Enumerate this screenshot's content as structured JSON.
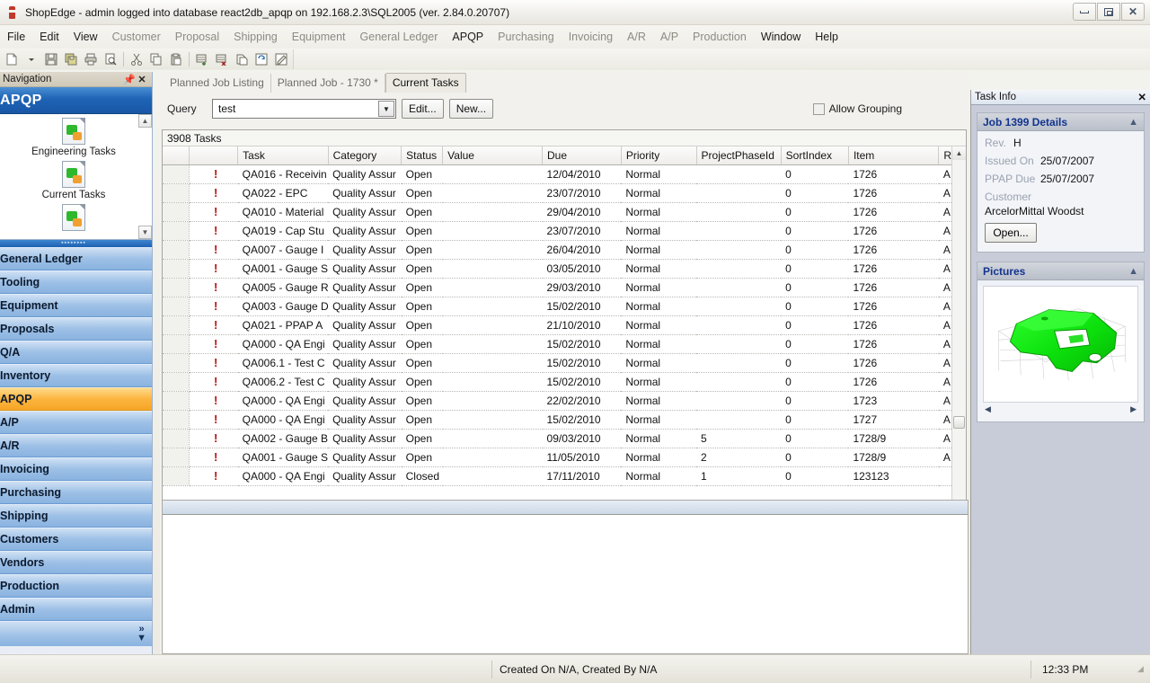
{
  "window": {
    "title": "ShopEdge - admin logged into database react2db_apqp on 192.168.2.3\\SQL2005 (ver. 2.84.0.20707)",
    "app_icon": "shopedge-icon",
    "minimize": "minimize-icon",
    "maximize": "maximize-icon",
    "close": "close-icon"
  },
  "menubar": {
    "items": [
      {
        "label": "File",
        "active": true
      },
      {
        "label": "Edit",
        "active": true
      },
      {
        "label": "View",
        "active": true
      },
      {
        "label": "Customer",
        "active": false
      },
      {
        "label": "Proposal",
        "active": false
      },
      {
        "label": "Shipping",
        "active": false
      },
      {
        "label": "Equipment",
        "active": false
      },
      {
        "label": "General Ledger",
        "active": false
      },
      {
        "label": "APQP",
        "active": true
      },
      {
        "label": "Purchasing",
        "active": false
      },
      {
        "label": "Invoicing",
        "active": false
      },
      {
        "label": "A/R",
        "active": false
      },
      {
        "label": "A/P",
        "active": false
      },
      {
        "label": "Production",
        "active": false
      },
      {
        "label": "Window",
        "active": true
      },
      {
        "label": "Help",
        "active": true
      }
    ]
  },
  "toolbar": {
    "buttons": [
      "new-document-icon",
      "new-dropdown-icon",
      "save-icon",
      "save-all-icon",
      "print-icon",
      "print-preview-icon",
      "cut-icon",
      "copy-icon",
      "paste-icon",
      "add-record-icon",
      "delete-record-icon",
      "copy-record-icon",
      "refresh-icon",
      "edit-note-icon"
    ]
  },
  "navigation": {
    "header_title": "Navigation",
    "pin_icon": "pin-icon",
    "close_icon": "close-icon",
    "section_title": "APQP",
    "shortcuts": [
      {
        "label": "Engineering Tasks",
        "icon": "puzzle-document-icon"
      },
      {
        "label": "Current Tasks",
        "icon": "puzzle-document-icon"
      },
      {
        "label": "",
        "icon": "puzzle-document-icon"
      }
    ],
    "scroll_up_icon": "chevron-up-icon",
    "scroll_down_icon": "chevron-down-icon",
    "groups": [
      {
        "label": "General Ledger",
        "selected": false
      },
      {
        "label": "Tooling",
        "selected": false
      },
      {
        "label": "Equipment",
        "selected": false
      },
      {
        "label": "Proposals",
        "selected": false
      },
      {
        "label": "Q/A",
        "selected": false
      },
      {
        "label": "Inventory",
        "selected": false
      },
      {
        "label": "APQP",
        "selected": true
      },
      {
        "label": "A/P",
        "selected": false
      },
      {
        "label": "A/R",
        "selected": false
      },
      {
        "label": "Invoicing",
        "selected": false
      },
      {
        "label": "Purchasing",
        "selected": false
      },
      {
        "label": "Shipping",
        "selected": false
      },
      {
        "label": "Customers",
        "selected": false
      },
      {
        "label": "Vendors",
        "selected": false
      },
      {
        "label": "Production",
        "selected": false
      },
      {
        "label": "Admin",
        "selected": false
      }
    ],
    "overflow_icon": "chevrons-right-icon"
  },
  "tabs": [
    {
      "label": "Planned Job Listing",
      "active": false
    },
    {
      "label": "Planned Job - 1730 *",
      "active": false
    },
    {
      "label": "Current Tasks",
      "active": true
    }
  ],
  "query": {
    "label": "Query",
    "value": "test",
    "placeholder": "",
    "dropdown_icon": "chevron-down-icon",
    "edit_label": "Edit...",
    "new_label": "New...",
    "allow_grouping_label": "Allow Grouping",
    "allow_grouping_checked": false
  },
  "grid": {
    "status_text": "3908 Tasks",
    "columns": [
      "",
      "",
      "Task",
      "Category",
      "Status",
      "Value",
      "Due",
      "Priority",
      "ProjectPhaseId",
      "SortIndex",
      "Item",
      "Rev"
    ],
    "flag_icon": "alert-exclamation-icon",
    "rows": [
      {
        "flag": "!",
        "task": "QA016 - Receivin",
        "category": "Quality Assur",
        "status": "Open",
        "value": "",
        "due": "12/04/2010",
        "priority": "Normal",
        "phase": "",
        "sortindex": "0",
        "item": "1726",
        "rev": "A"
      },
      {
        "flag": "!",
        "task": "QA022 - EPC",
        "category": "Quality Assur",
        "status": "Open",
        "value": "",
        "due": "23/07/2010",
        "priority": "Normal",
        "phase": "",
        "sortindex": "0",
        "item": "1726",
        "rev": "A"
      },
      {
        "flag": "!",
        "task": "QA010 - Material",
        "category": "Quality Assur",
        "status": "Open",
        "value": "",
        "due": "29/04/2010",
        "priority": "Normal",
        "phase": "",
        "sortindex": "0",
        "item": "1726",
        "rev": "A"
      },
      {
        "flag": "!",
        "task": "QA019 - Cap Stu",
        "category": "Quality Assur",
        "status": "Open",
        "value": "",
        "due": "23/07/2010",
        "priority": "Normal",
        "phase": "",
        "sortindex": "0",
        "item": "1726",
        "rev": "A"
      },
      {
        "flag": "!",
        "task": "QA007 - Gauge I",
        "category": "Quality Assur",
        "status": "Open",
        "value": "",
        "due": "26/04/2010",
        "priority": "Normal",
        "phase": "",
        "sortindex": "0",
        "item": "1726",
        "rev": "A"
      },
      {
        "flag": "!",
        "task": "QA001 - Gauge S",
        "category": "Quality Assur",
        "status": "Open",
        "value": "",
        "due": "03/05/2010",
        "priority": "Normal",
        "phase": "",
        "sortindex": "0",
        "item": "1726",
        "rev": "A"
      },
      {
        "flag": "!",
        "task": "QA005 - Gauge R",
        "category": "Quality Assur",
        "status": "Open",
        "value": "",
        "due": "29/03/2010",
        "priority": "Normal",
        "phase": "",
        "sortindex": "0",
        "item": "1726",
        "rev": "A"
      },
      {
        "flag": "!",
        "task": "QA003 - Gauge D",
        "category": "Quality Assur",
        "status": "Open",
        "value": "",
        "due": "15/02/2010",
        "priority": "Normal",
        "phase": "",
        "sortindex": "0",
        "item": "1726",
        "rev": "A"
      },
      {
        "flag": "!",
        "task": "QA021 - PPAP A",
        "category": "Quality Assur",
        "status": "Open",
        "value": "",
        "due": "21/10/2010",
        "priority": "Normal",
        "phase": "",
        "sortindex": "0",
        "item": "1726",
        "rev": "A"
      },
      {
        "flag": "!",
        "task": "QA000 - QA Engi",
        "category": "Quality Assur",
        "status": "Open",
        "value": "",
        "due": "15/02/2010",
        "priority": "Normal",
        "phase": "",
        "sortindex": "0",
        "item": "1726",
        "rev": "A"
      },
      {
        "flag": "!",
        "task": "QA006.1 - Test C",
        "category": "Quality Assur",
        "status": "Open",
        "value": "",
        "due": "15/02/2010",
        "priority": "Normal",
        "phase": "",
        "sortindex": "0",
        "item": "1726",
        "rev": "A"
      },
      {
        "flag": "!",
        "task": "QA006.2 - Test C",
        "category": "Quality Assur",
        "status": "Open",
        "value": "",
        "due": "15/02/2010",
        "priority": "Normal",
        "phase": "",
        "sortindex": "0",
        "item": "1726",
        "rev": "A"
      },
      {
        "flag": "!",
        "task": "QA000 - QA Engi",
        "category": "Quality Assur",
        "status": "Open",
        "value": "",
        "due": "22/02/2010",
        "priority": "Normal",
        "phase": "",
        "sortindex": "0",
        "item": "1723",
        "rev": "A"
      },
      {
        "flag": "!",
        "task": "QA000 - QA Engi",
        "category": "Quality Assur",
        "status": "Open",
        "value": "",
        "due": "15/02/2010",
        "priority": "Normal",
        "phase": "",
        "sortindex": "0",
        "item": "1727",
        "rev": "A"
      },
      {
        "flag": "!",
        "task": "QA002 - Gauge B",
        "category": "Quality Assur",
        "status": "Open",
        "value": "",
        "due": "09/03/2010",
        "priority": "Normal",
        "phase": "5",
        "sortindex": "0",
        "item": "1728/9",
        "rev": "A"
      },
      {
        "flag": "!",
        "task": "QA001 - Gauge S",
        "category": "Quality Assur",
        "status": "Open",
        "value": "",
        "due": "11/05/2010",
        "priority": "Normal",
        "phase": "2",
        "sortindex": "0",
        "item": "1728/9",
        "rev": "A"
      },
      {
        "flag": "!",
        "task": "QA000 - QA Engi",
        "category": "Quality Assur",
        "status": "Closed",
        "value": "",
        "due": "17/11/2010",
        "priority": "Normal",
        "phase": "1",
        "sortindex": "0",
        "item": "123123",
        "rev": ""
      }
    ],
    "hscroll_grip": "‖",
    "scroll_left_icon": "triangle-left-icon",
    "scroll_right_icon": "triangle-right-icon",
    "scroll_up_icon": "triangle-up-icon",
    "scroll_down_icon": "triangle-down-icon"
  },
  "task_info": {
    "panel_title": "Task Info",
    "close_icon": "close-icon",
    "job_card": {
      "title": "Job 1399 Details",
      "collapse_icon": "chevrons-up-icon",
      "rev_label": "Rev.",
      "rev_value": "H",
      "issued_on_label": "Issued On",
      "issued_on_value": "25/07/2007",
      "ppap_due_label": "PPAP Due",
      "ppap_due_value": "25/07/2007",
      "customer_label": "Customer",
      "customer_value": "ArcelorMittal Woodst",
      "open_label": "Open..."
    },
    "pictures_card": {
      "title": "Pictures",
      "collapse_icon": "chevrons-up-icon",
      "image_alt": "green-3d-part-render",
      "prev_icon": "triangle-left-icon",
      "next_icon": "triangle-right-icon"
    }
  },
  "statusbar": {
    "created_text": "Created On N/A, Created By N/A",
    "time": "12:33 PM",
    "grip_icon": "resize-grip-icon"
  },
  "colors": {
    "accent_blue": "#1e63b5",
    "selected_orange": "#f6a526",
    "flag_red": "#b81414",
    "card_title_blue": "#12348e",
    "part_green": "#12e012"
  }
}
